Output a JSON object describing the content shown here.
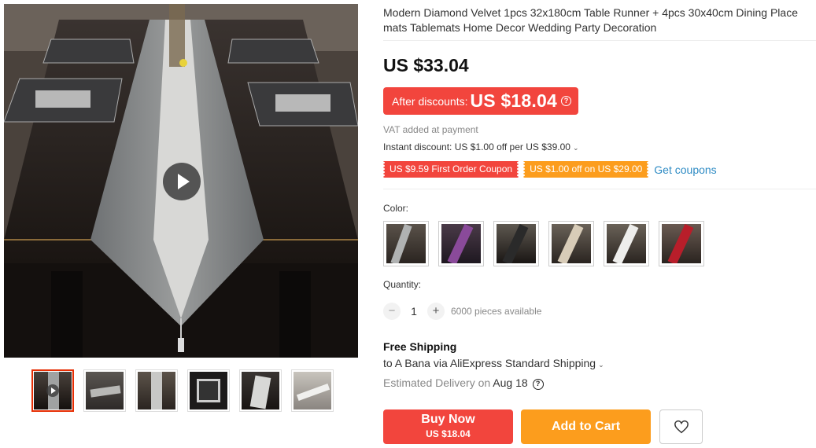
{
  "product": {
    "title": "Modern Diamond Velvet 1pcs 32x180cm Table Runner + 4pcs 30x40cm Dining Place mats Tablemats Home Decor Wedding Party Decoration",
    "price": "US $33.04",
    "discount_label": "After discounts:",
    "discount_price": "US $18.04",
    "vat_note": "VAT added at payment",
    "instant_discount": "Instant discount: US $1.00 off per US $39.00"
  },
  "coupons": {
    "first_order": "US $9.59 First Order Coupon",
    "store": "US $1.00 off on US $29.00",
    "get_link": "Get coupons"
  },
  "color": {
    "label": "Color:",
    "options": [
      "gray-silver",
      "purple",
      "black",
      "champagne",
      "white",
      "red"
    ]
  },
  "quantity": {
    "label": "Quantity:",
    "value": "1",
    "minus": "−",
    "plus": "+",
    "available": "6000 pieces available"
  },
  "shipping": {
    "title": "Free Shipping",
    "via": "to A Bana via AliExpress Standard Shipping",
    "est_prefix": "Estimated Delivery on",
    "est_date": "Aug 18"
  },
  "actions": {
    "buy_now": "Buy Now",
    "buy_now_price": "US $18.04",
    "add_to_cart": "Add to Cart"
  },
  "icons": {
    "play": "play-icon",
    "info": "info-icon",
    "chevron": "chevron-down-icon",
    "help": "question-icon",
    "wishlist": "heart-icon"
  },
  "colors": {
    "accent_red": "#f2453d",
    "accent_orange": "#fc9d1d",
    "link_blue": "#2e8bc4"
  }
}
